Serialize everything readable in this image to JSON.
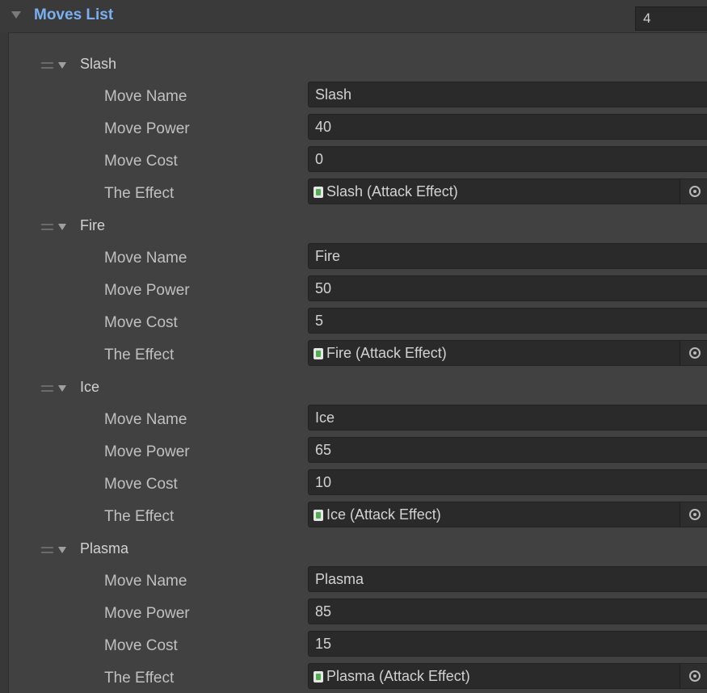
{
  "header": {
    "title": "Moves List",
    "size_value": "4"
  },
  "labels": {
    "move_name": "Move Name",
    "move_power": "Move Power",
    "move_cost": "Move Cost",
    "the_effect": "The Effect"
  },
  "moves": [
    {
      "element_label": "Slash",
      "move_name": "Slash",
      "move_power": "40",
      "move_cost": "0",
      "effect": "Slash (Attack Effect)"
    },
    {
      "element_label": "Fire",
      "move_name": "Fire",
      "move_power": "50",
      "move_cost": "5",
      "effect": "Fire (Attack Effect)"
    },
    {
      "element_label": "Ice",
      "move_name": "Ice",
      "move_power": "65",
      "move_cost": "10",
      "effect": "Ice (Attack Effect)"
    },
    {
      "element_label": "Plasma",
      "move_name": "Plasma",
      "move_power": "85",
      "move_cost": "15",
      "effect": "Plasma (Attack Effect)"
    }
  ],
  "icons": {
    "foldout": "triangle-down-icon",
    "drag_handle": "drag-handle-icon",
    "object_field": "script-asset-icon",
    "picker": "object-picker-icon"
  },
  "colors": {
    "header_title": "#7ab0f0",
    "background": "#383838",
    "field_background": "#2a2a2a",
    "asset_icon": "#4fae4f"
  }
}
